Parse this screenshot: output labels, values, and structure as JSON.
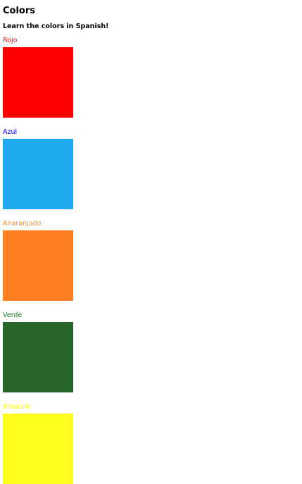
{
  "title": "Colors",
  "subtitle": "Learn the colors in Spanish!",
  "colors": [
    {
      "name": "Rojo",
      "text_color": "#ff0000",
      "swatch": "#ff0000"
    },
    {
      "name": "Azul",
      "text_color": "#0000ff",
      "swatch": "#1faaf0"
    },
    {
      "name": "Anaranjado",
      "text_color": "#ff8a22",
      "swatch": "#ff7f22"
    },
    {
      "name": "Verde",
      "text_color": "#1e7a2a",
      "swatch": "#27652a"
    },
    {
      "name": "Amarillo",
      "text_color": "#ffff00",
      "swatch": "#ffff22"
    }
  ]
}
